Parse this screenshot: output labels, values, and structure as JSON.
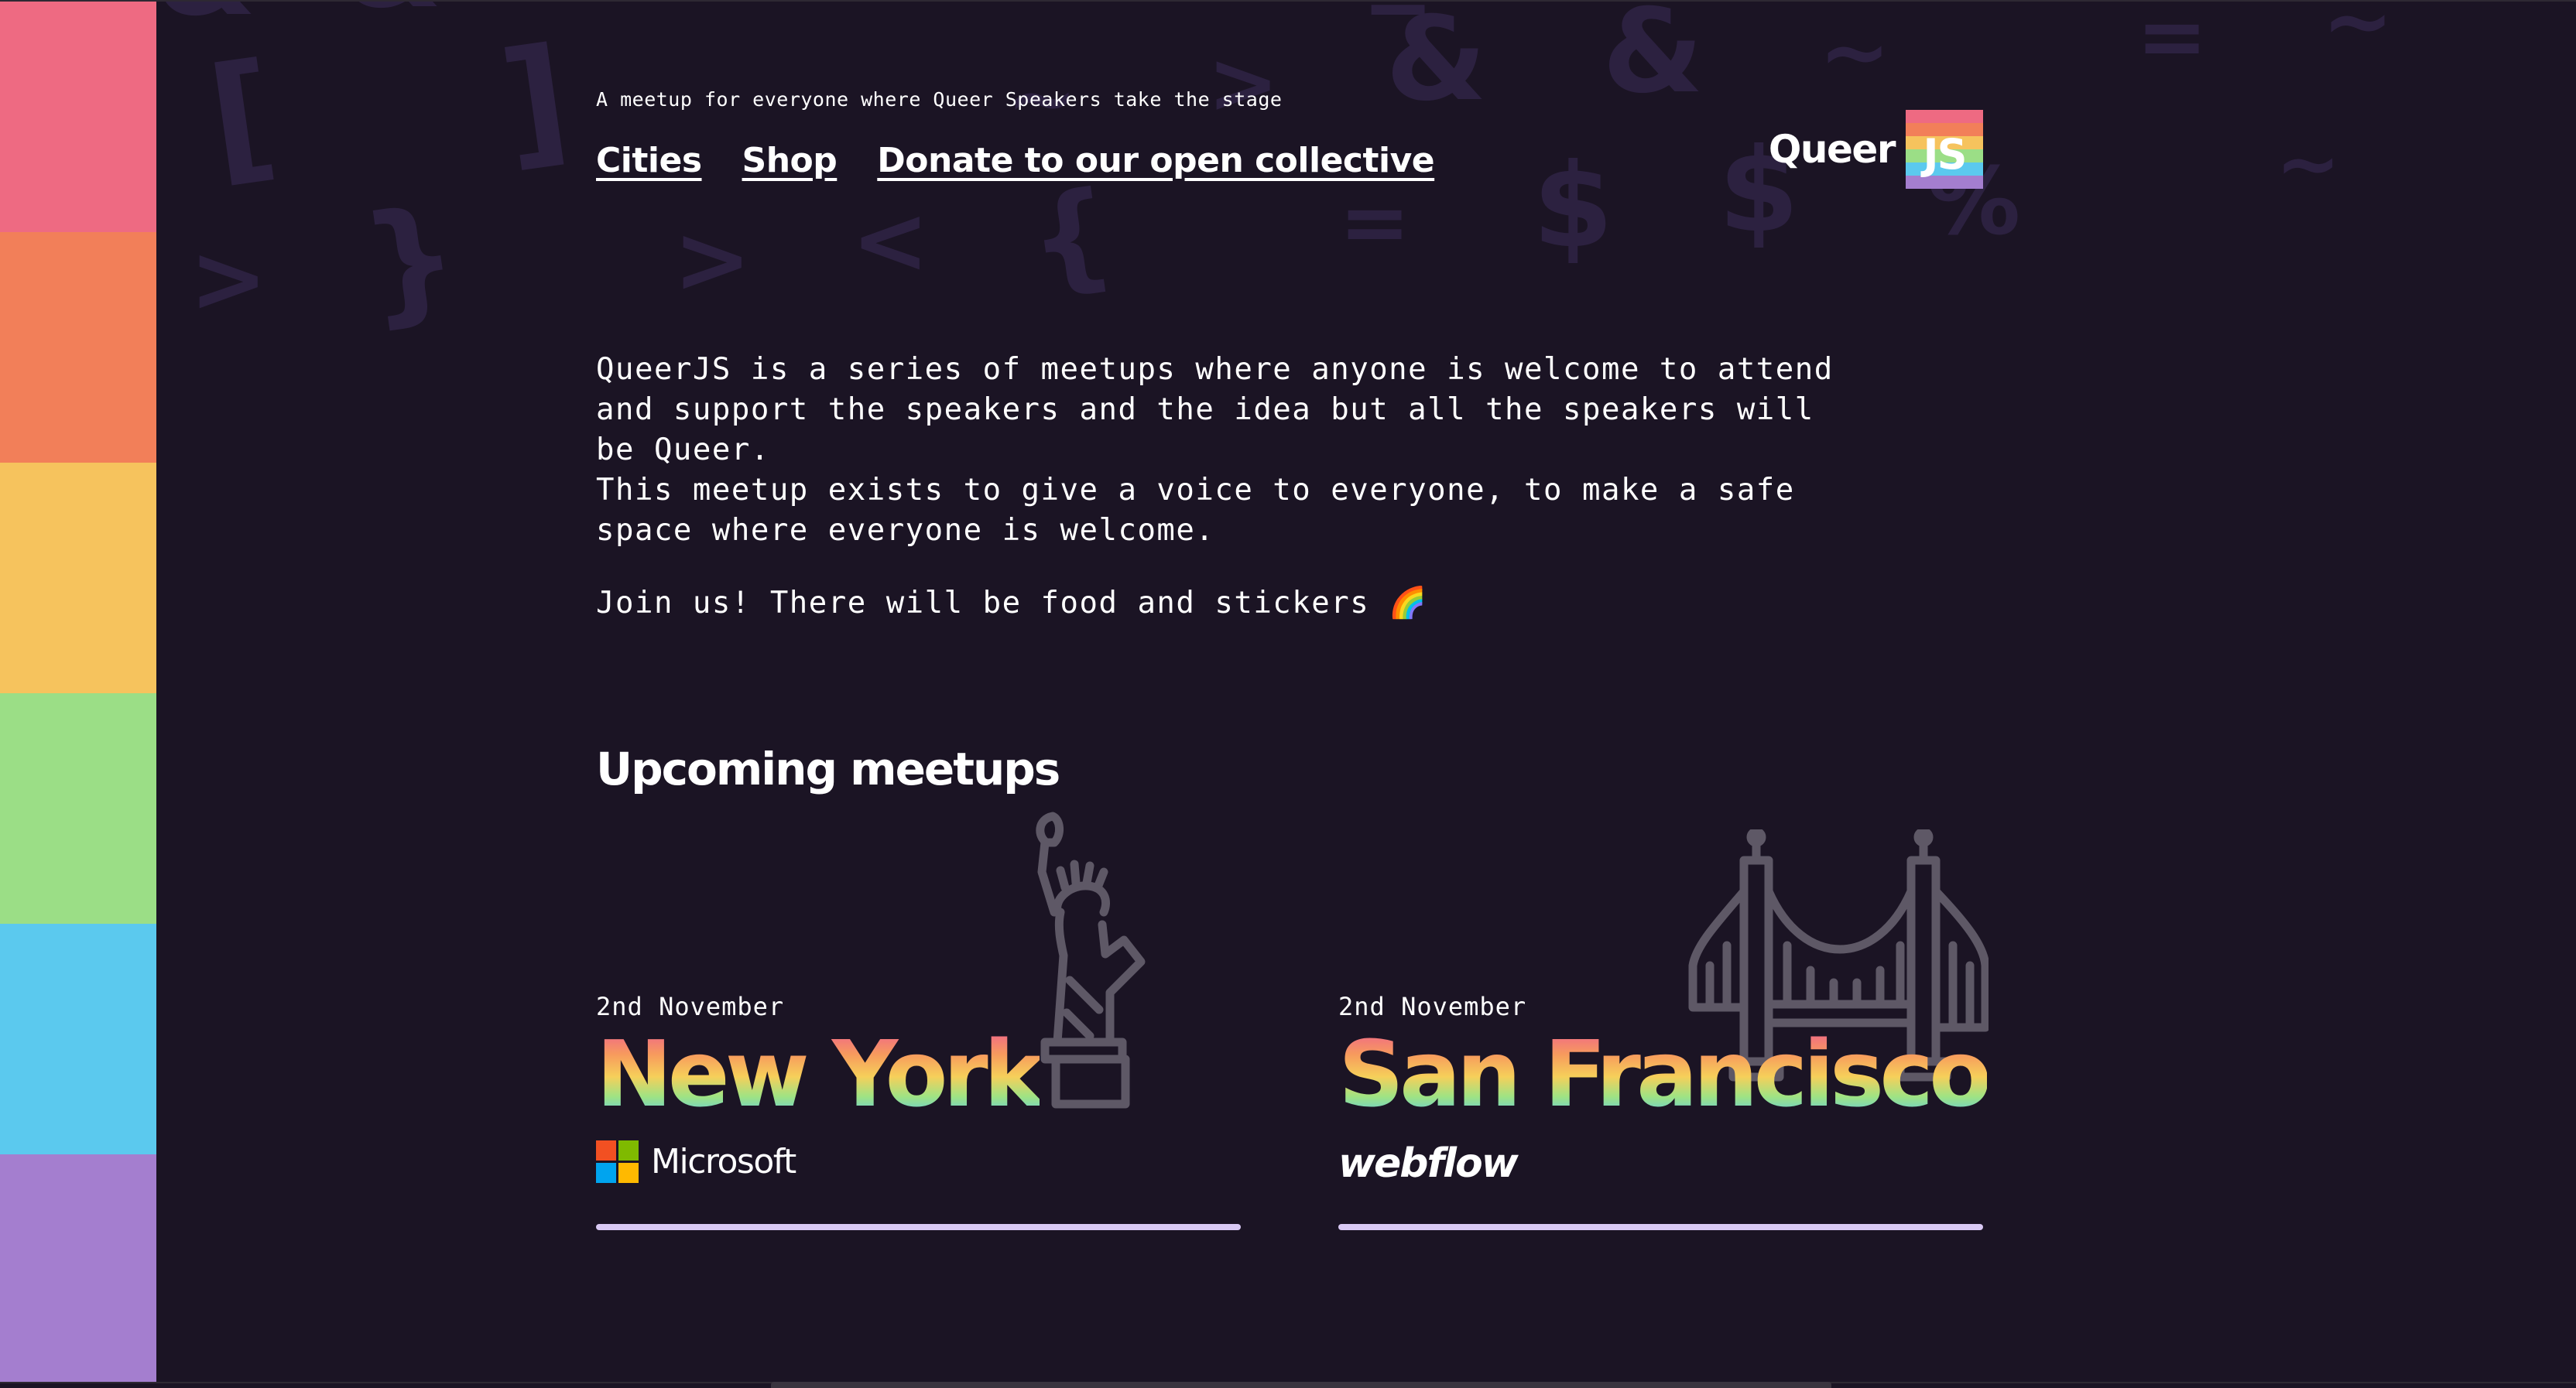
{
  "colors": {
    "background": "#1b1424",
    "rainbow": [
      "#ee6a82",
      "#f27f59",
      "#f6c35d",
      "#9bde86",
      "#5bc9ee",
      "#a47ecf"
    ],
    "symbol": "#2c2140",
    "card_underline": "#d9c9f4",
    "microsoft": [
      "#f25022",
      "#7fba00",
      "#00a4ef",
      "#ffb900"
    ]
  },
  "header": {
    "tagline": "A meetup for everyone where Queer Speakers take the stage",
    "nav": [
      "Cities",
      "Shop",
      "Donate to our open collective"
    ],
    "logo": {
      "word": "Queer",
      "badge": "JS"
    }
  },
  "intro": {
    "paragraph": "QueerJS is a series of meetups where anyone is welcome to attend and support the speakers and the idea but all the speakers will be Queer.",
    "paragraph2": "This meetup exists to give a voice to everyone, to make a safe space where everyone is welcome.",
    "join": "Join us! There will be food and stickers 🌈"
  },
  "upcoming": {
    "title": "Upcoming meetups",
    "meetups": [
      {
        "date": "2nd November",
        "city": "New York",
        "sponsor": "Microsoft",
        "icon": "statue-of-liberty-icon"
      },
      {
        "date": "2nd November",
        "city": "San Francisco",
        "sponsor": "webflow",
        "icon": "golden-gate-bridge-icon"
      }
    ]
  },
  "background_symbols": [
    "[",
    "]",
    "}",
    ">",
    ">",
    "<",
    "{",
    "=",
    "~",
    ">",
    "&",
    "&",
    "~",
    "=",
    "$",
    "$",
    "%",
    "~",
    "=",
    "~",
    "&",
    "&"
  ]
}
